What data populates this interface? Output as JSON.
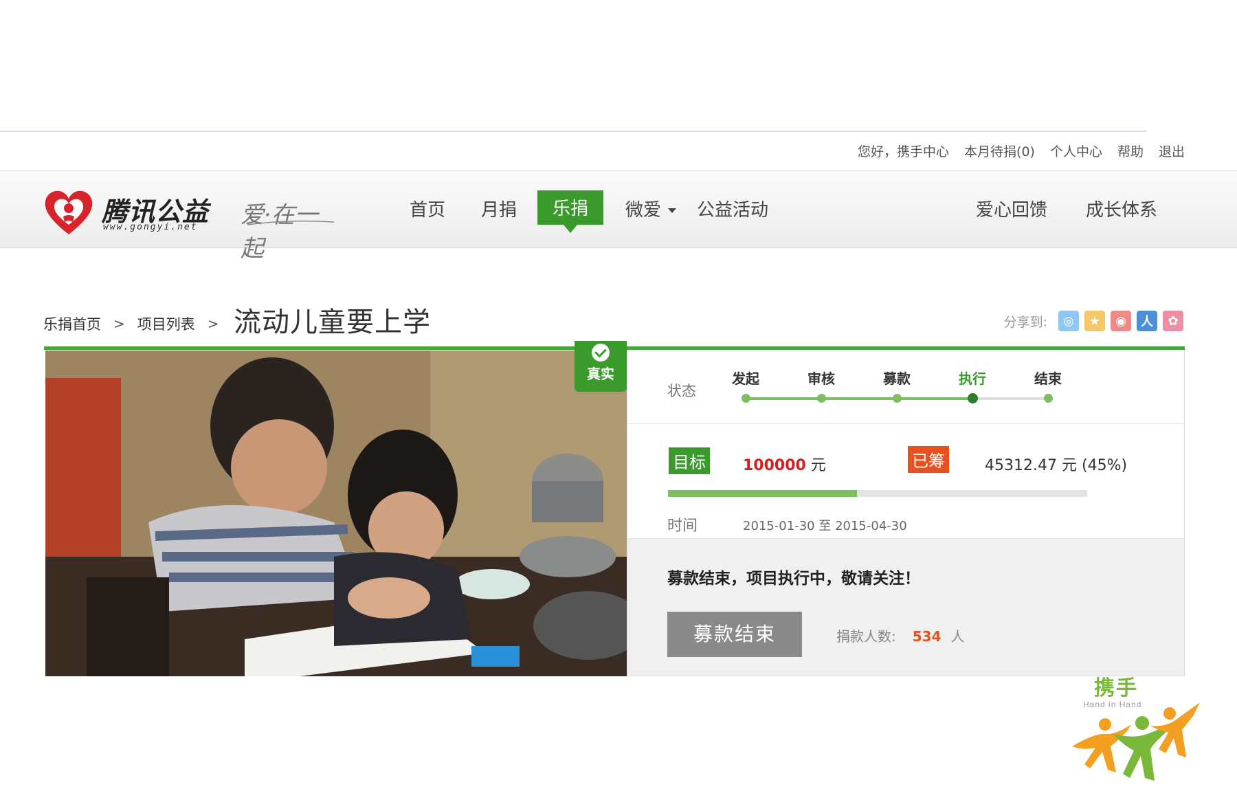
{
  "userbar": {
    "greeting": "您好，携手中心",
    "pending": "本月待捐(0)",
    "profile": "个人中心",
    "help": "帮助",
    "logout": "退出"
  },
  "brand": {
    "name": "腾讯公益",
    "url": "www.gongyi.net",
    "slogan": "爱·在一起"
  },
  "nav": {
    "home": "首页",
    "monthly": "月捐",
    "lejuan": "乐捐",
    "weiai": "微爱",
    "activities": "公益活动",
    "feedback": "爱心回馈",
    "growth": "成长体系"
  },
  "breadcrumb": {
    "home": "乐捐首页",
    "list": "项目列表",
    "sep": ">"
  },
  "project": {
    "title": "流动儿童要上学",
    "verified_label": "真实"
  },
  "share": {
    "label": "分享到:",
    "icons": [
      "qzone-icon",
      "star-icon",
      "weibo-icon",
      "renren-icon",
      "kaixin-icon"
    ]
  },
  "status": {
    "label": "状态",
    "steps": [
      "发起",
      "审核",
      "募款",
      "执行",
      "结束"
    ],
    "current_step_index": 3
  },
  "funding": {
    "target_label": "目标",
    "target_amount": "100000",
    "currency": "元",
    "raised_label": "已筹",
    "raised_amount": "45312.47",
    "raised_percent_text": "(45%)",
    "progress": 0.45
  },
  "time": {
    "label": "时间",
    "start": "2015-01-30",
    "to": "至",
    "end": "2015-04-30"
  },
  "closing": {
    "notice": "募款结束，项目执行中，敬请关注！",
    "button": "募款结束",
    "donors_label": "捐款人数:",
    "donors_count": "534",
    "donors_unit": "人"
  },
  "watermark": {
    "title": "携手",
    "subtitle": "Hand in Hand"
  },
  "colors": {
    "green": "#3a9a2c",
    "orange": "#e8501f",
    "red": "#d52020"
  }
}
